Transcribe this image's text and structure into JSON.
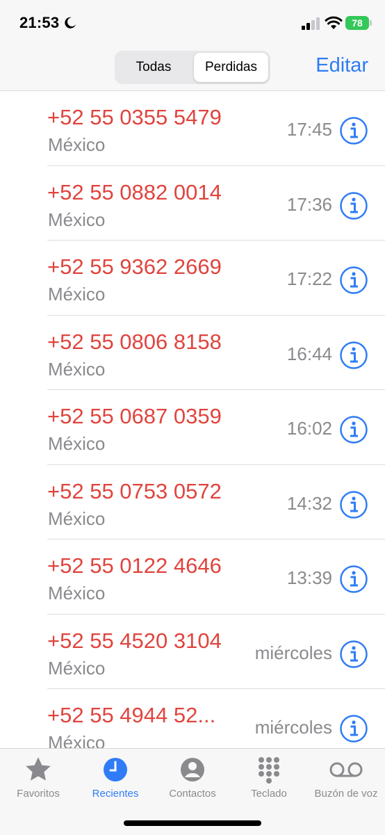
{
  "status_bar": {
    "time": "21:53",
    "battery": "78",
    "icons": [
      "moon-icon",
      "signal-icon",
      "wifi-icon",
      "battery-icon"
    ]
  },
  "header": {
    "segments": [
      "Todas",
      "Perdidas"
    ],
    "selected_segment": "Perdidas",
    "edit_label": "Editar"
  },
  "calls": [
    {
      "number": "+52 55 0355 5479",
      "location": "México",
      "time": "17:45"
    },
    {
      "number": "+52 55 0882 0014",
      "location": "México",
      "time": "17:36"
    },
    {
      "number": "+52 55 9362 2669",
      "location": "México",
      "time": "17:22"
    },
    {
      "number": "+52 55 0806 8158",
      "location": "México",
      "time": "16:44"
    },
    {
      "number": "+52 55 0687 0359",
      "location": "México",
      "time": "16:02"
    },
    {
      "number": "+52 55 0753 0572",
      "location": "México",
      "time": "14:32"
    },
    {
      "number": "+52 55 0122 4646",
      "location": "México",
      "time": "13:39"
    },
    {
      "number": "+52 55 4520 3104",
      "location": "México",
      "time": "miércoles"
    },
    {
      "number": "+52 55 4944 52...",
      "location": "México",
      "time": "miércoles"
    }
  ],
  "tab_bar": {
    "tabs": [
      {
        "label": "Favoritos",
        "icon": "star-icon"
      },
      {
        "label": "Recientes",
        "icon": "clock-icon"
      },
      {
        "label": "Contactos",
        "icon": "person-icon"
      },
      {
        "label": "Teclado",
        "icon": "keypad-icon"
      },
      {
        "label": "Buzón de voz",
        "icon": "voicemail-icon"
      }
    ],
    "active": "Recientes"
  },
  "colors": {
    "accent": "#2f7cf6",
    "missed_call": "#e0443e",
    "secondary_text": "#8a8a8e",
    "battery": "#34c759"
  }
}
